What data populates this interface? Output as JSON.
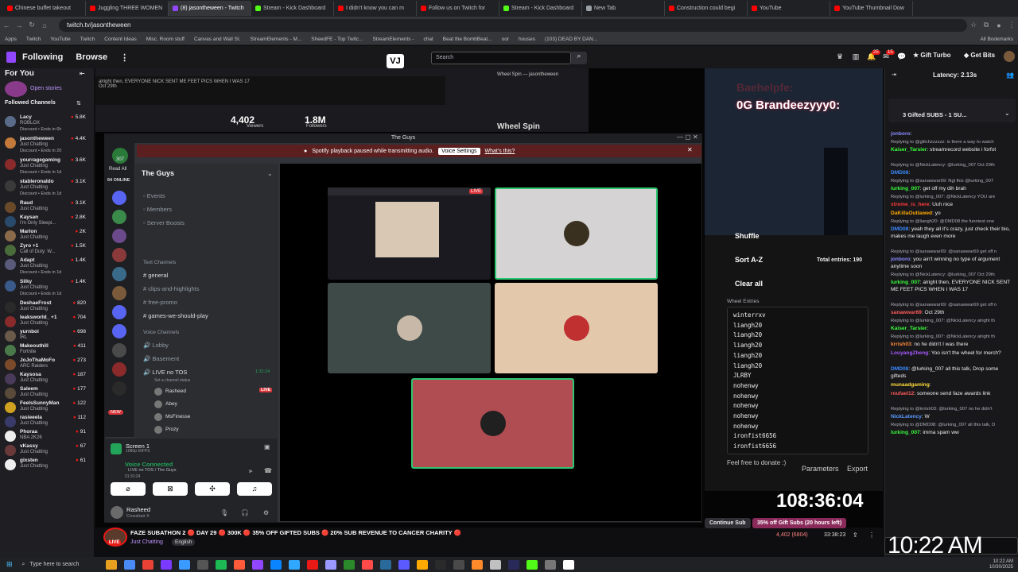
{
  "browser": {
    "tabs": [
      {
        "label": "Chinese buffet takeout",
        "color": "#ff0000"
      },
      {
        "label": "Juggling THREE WOMEN",
        "color": "#ff0000"
      },
      {
        "label": "(8) jasontheween - Twitch",
        "color": "#9146ff"
      },
      {
        "label": "Stream - Kick Dashboard",
        "color": "#53fc18"
      },
      {
        "label": "I didn't know you can m",
        "color": "#ff0000"
      },
      {
        "label": "Follow us on Twitch for",
        "color": "#ff0000"
      },
      {
        "label": "Stream - Kick Dashboard",
        "color": "#53fc18"
      },
      {
        "label": "New Tab",
        "color": "#9aa0a6"
      },
      {
        "label": "Construction could begi",
        "color": "#ff0000"
      },
      {
        "label": "YouTube",
        "color": "#ff0000"
      },
      {
        "label": "YouTube Thumbnail Dow",
        "color": "#ff0000"
      }
    ],
    "url": "twitch.tv/jasontheween",
    "bookmarks": [
      "Apps",
      "Twitch",
      "YouTube",
      "Twitch",
      "Content Ideas",
      "Misc. Room stuff",
      "Canvas and Wall St.",
      "StreamElements - M...",
      "SheedFE - Top Twitc...",
      "StreamElements -",
      "chat",
      "Beat the BombBeat...",
      "oor",
      "houses",
      "(103) DEAD BY DAN..."
    ],
    "all_bookmarks": "All Bookmarks"
  },
  "twitch": {
    "following": "Following",
    "browse": "Browse",
    "search_placeholder": "Search",
    "vj": "VJ",
    "gift_turbo": "Gift Turbo",
    "get_bits": "Get Bits",
    "badge1": "25",
    "badge2": "15",
    "sidebar": {
      "for_you": "For You",
      "open_stories": "Open stories",
      "followed_channels": "Followed Channels",
      "channels": [
        {
          "name": "Lacy",
          "game": "ROBLOX",
          "viewers": "5.8K",
          "discount": "Discount • Ends in 6h",
          "color": "#5a6b8a"
        },
        {
          "name": "jasontheween",
          "game": "Just Chatting",
          "viewers": "4.4K",
          "discount": "Discount • Ends in 20",
          "color": "#c47a3a"
        },
        {
          "name": "yourragegaming",
          "game": "Just Chatting",
          "viewers": "3.6K",
          "discount": "Discount • Ends in 1d",
          "color": "#8a2a2a"
        },
        {
          "name": "stableronaldo",
          "game": "Just Chatting",
          "viewers": "3.1K",
          "discount": "Discount • Ends in 1d",
          "color": "#3a3a3a"
        },
        {
          "name": "Raud",
          "game": "Just Chatting",
          "viewers": "3.1K",
          "discount": "",
          "color": "#6b4a2a"
        },
        {
          "name": "Kaysan",
          "game": "I'm Only Sleepi...",
          "viewers": "2.8K",
          "discount": "",
          "color": "#2a4a6b"
        },
        {
          "name": "Marlon",
          "game": "Just Chatting",
          "viewers": "2K",
          "discount": "",
          "color": "#8a6a4a"
        },
        {
          "name": "Zyro +1",
          "game": "Call of Duty: W...",
          "viewers": "1.5K",
          "discount": "",
          "color": "#4a6b3a"
        },
        {
          "name": "Adapt",
          "game": "Just Chatting",
          "viewers": "1.4K",
          "discount": "Discount • Ends in 1d",
          "color": "#5a5a7a"
        },
        {
          "name": "Silky",
          "game": "Just Chatting",
          "viewers": "1.4K",
          "discount": "Discount • Ends in 1d",
          "color": "#3a5a8a"
        },
        {
          "name": "DeshaeFrost",
          "game": "Just Chatting",
          "viewers": "820",
          "discount": "",
          "color": "#2a2a2a"
        },
        {
          "name": "leaksworld_ +1",
          "game": "Just Chatting",
          "viewers": "704",
          "discount": "",
          "color": "#8a2a2a"
        },
        {
          "name": "yurnboi",
          "game": "IRL",
          "viewers": "698",
          "discount": "",
          "color": "#6a5a4a"
        },
        {
          "name": "Makeouthill",
          "game": "Fortnite",
          "viewers": "411",
          "discount": "",
          "color": "#4a7a4a"
        },
        {
          "name": "JoJoThaMoFo",
          "game": "ARC Raiders",
          "viewers": "273",
          "discount": "",
          "color": "#7a4a2a"
        },
        {
          "name": "Kaysosa",
          "game": "Just Chatting",
          "viewers": "187",
          "discount": "",
          "color": "#4a3a5a"
        },
        {
          "name": "Saleem",
          "game": "Just Chatting",
          "viewers": "177",
          "discount": "",
          "color": "#5a4a3a"
        },
        {
          "name": "FeelsSunnyMan",
          "game": "Just Chatting",
          "viewers": "122",
          "discount": "",
          "color": "#d0a020"
        },
        {
          "name": "rasieeela",
          "game": "Just Chatting",
          "viewers": "112",
          "discount": "",
          "color": "#3a3a6a"
        },
        {
          "name": "Phoraa",
          "game": "NBA 2K26",
          "viewers": "91",
          "discount": "",
          "color": "#eeeeee"
        },
        {
          "name": "vKassy",
          "game": "Just Chatting",
          "viewers": "67",
          "discount": "",
          "color": "#6a3a3a"
        },
        {
          "name": "gixsten",
          "game": "Just Chatting",
          "viewers": "61",
          "discount": "",
          "color": "#eeeeee"
        }
      ]
    }
  },
  "stream": {
    "inner_viewers": "4,402",
    "inner_viewers_label": "Viewers",
    "inner_followers": "1.8M",
    "inner_followers_label": "Followers",
    "overlay_name1": "Baehelpfe:",
    "overlay_name2": "0G Brandeezyyy0:",
    "wheel_title": "Wheel Spin",
    "wheel_tab": "Wheel Spin — jasontheween",
    "timer": "108:36:04",
    "title": "FAZE SUBATHON 2 🔴 DAY 29 🔴 300K 🔴 35% OFF GIFTED SUBS 🔴 20% SUB REVENUE TO CANCER CHARITY 🔴",
    "category": "Just Chatting",
    "language": "English",
    "live": "LIVE",
    "viewers_count": "4,402 (6804)",
    "uptime": "33:38:23",
    "continue_sub": "Continue Sub",
    "gift_offer": "35% off Gift Subs (20 hours left)",
    "clock": "10:22 AM"
  },
  "discord": {
    "window_title": "The Guys",
    "spotify_notice": "Spotify playback paused while transmitting audio.",
    "voice_settings": "Voice Settings",
    "whats_this": "What's this?",
    "server_name": "The Guys",
    "read_all": "Read All",
    "online": "64 ONLINE",
    "items": [
      "Events",
      "Members",
      "Server Boosts"
    ],
    "text_channels_label": "Text Channels",
    "text_channels": [
      "general",
      "clips-and-highlights",
      "free-promo",
      "games-we-should-play"
    ],
    "voice_channels_label": "Voice Channels",
    "voice_channels": [
      "Lobby",
      "Basement",
      "LIVE no TOS"
    ],
    "live_status": "Set a channel status",
    "voice_timer": "1:31:24",
    "members": [
      "Rasheed",
      "Abey",
      "MsFinesse",
      "Prozy"
    ],
    "screen_label": "Screen 1",
    "screen_sub": "1080p 60FPS",
    "voice_connected": "Voice Connected",
    "voice_sub": "LIVE no TOS / The Guys",
    "voice_time": "01:31:24",
    "user_name": "Rasheed",
    "user_status": "Crosshair X",
    "badge_new": "NEW",
    "notif": "307"
  },
  "wheel": {
    "shuffle": "Shuffle",
    "sort": "Sort A-Z",
    "clear": "Clear all",
    "entries_label": "Wheel Entries",
    "total_label": "Total entries:",
    "total": "190",
    "entries": [
      "winterrxv",
      "liangh20",
      "liangh20",
      "liangh20",
      "liangh20",
      "liangh20",
      "JLRBY",
      "nohenwy",
      "nohenwy",
      "nohenwy",
      "nohenwy",
      "nohenwy",
      "ironfist6656",
      "ironfist6656"
    ],
    "donate": "Feel free to donate :)",
    "parameters": "Parameters",
    "export": "Export"
  },
  "chat": {
    "latency": "Latency: 2.13s",
    "gifted_header": "3 Gifted SUBS - 1 SU...",
    "messages": [
      {
        "reply": "",
        "user": "jonboro",
        "color": "#8a8aff",
        "text": ""
      },
      {
        "reply": "Replying to @glitchzzzzzz: is there a way to watch",
        "user": "Kaiser_Tarsier",
        "color": "#3aff3a",
        "text": "streamrecord website i forfot"
      },
      {
        "reply": "Replying to @NickLatency: @lurking_007 Oct 29th",
        "user": "DMD08",
        "color": "#3a8aff",
        "text": ""
      },
      {
        "reply": "Replying to @sanawwar69: Ngl this @lurking_007",
        "user": "lurking_007",
        "color": "#3aff3a",
        "text": "get off my dih brah"
      },
      {
        "reply": "Replying to @lurking_007: @NickLatency YOU are",
        "user": "xtreme_is_here",
        "color": "#ff3a3a",
        "text": "Uuh nice"
      },
      {
        "reply": "",
        "user": "DaKillaOutlawed",
        "color": "#ffaa00",
        "text": "yo"
      },
      {
        "reply": "Replying to @liangh20: @DMD08 the funniest one",
        "user": "DMD08",
        "color": "#3a8aff",
        "text": "yeah they all it's crazy, just check their bio, makes me laugh even more"
      },
      {
        "reply": "Replying to @sanawwar69: @sanawwar69 get off n",
        "user": "jonboro",
        "color": "#8a8aff",
        "text": "you ain't winning no type of argument anytime soon"
      },
      {
        "reply": "Replying to @NickLatency: @lurking_007 Oct 29th",
        "user": "lurking_007",
        "color": "#3aff3a",
        "text": "alright then, EVERYONE NICK SENT ME FEET PICS WHEN I WAS 17"
      },
      {
        "reply": "Replying to @sanawwar69: @sanawwar69 get off n",
        "user": "sanawwar69",
        "color": "#ff5a5a",
        "text": "Oct 29th"
      },
      {
        "reply": "Replying to @lurking_007: @NickLatency alright th",
        "user": "Kaiser_Tarsier",
        "color": "#3aff3a",
        "text": ""
      },
      {
        "reply": "Replying to @lurking_007: @NickLatency alright th",
        "user": "krrish03",
        "color": "#ff8a3a",
        "text": "no he didn't I was there"
      },
      {
        "reply": "",
        "user": "LouyangZheng",
        "color": "#aa5aff",
        "text": "Yoo isn't the wheel for merch?"
      },
      {
        "reply": "",
        "user": "DMD08",
        "color": "#3a8aff",
        "text": "@lurking_007 all this talk, Drop some gifteds"
      },
      {
        "reply": "",
        "user": "munaadgaming",
        "color": "#ffdd3a",
        "text": ""
      },
      {
        "reply": "",
        "user": "roufael12",
        "color": "#ff5a5a",
        "text": "someone send faze awards link"
      },
      {
        "reply": "Replying to @krrish03: @lurking_007 no he didn't",
        "user": "NickLatency",
        "color": "#5a9aff",
        "text": "W"
      },
      {
        "reply": "Replying to @DMD08: @lurking_007 all this talk, D",
        "user": "lurking_007",
        "color": "#3aff3a",
        "text": "imma spam ww"
      }
    ]
  },
  "taskbar": {
    "search": "Type here to search",
    "time": "10:22 AM",
    "date": "10/30/2025"
  }
}
